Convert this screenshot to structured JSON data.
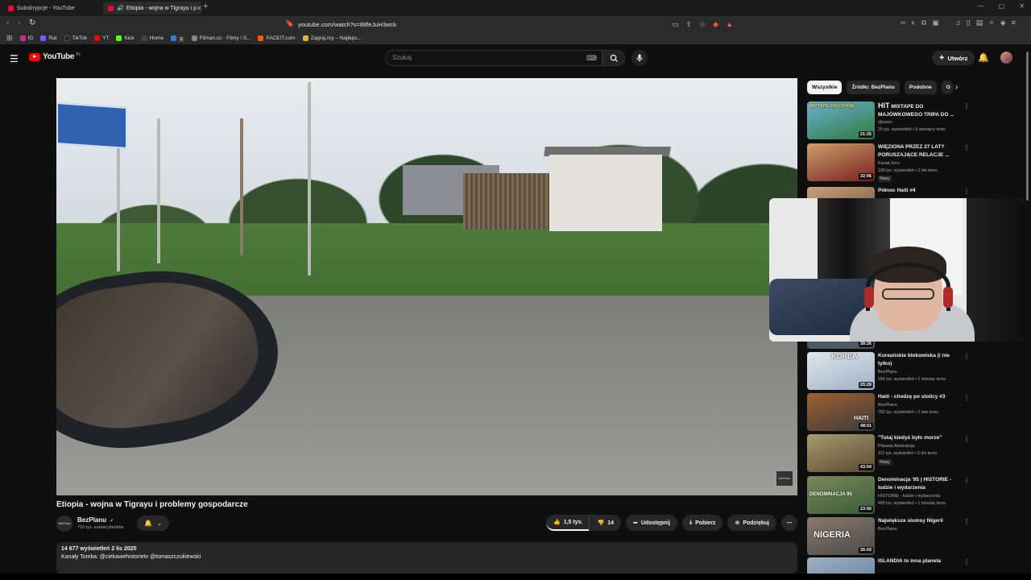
{
  "browser": {
    "tabs": [
      {
        "title": "Subskrypcje - YouTube",
        "active": false
      },
      {
        "title": "Etiopia - wojna w Tigrayu i p",
        "active": true
      }
    ],
    "url": "youtube.com/watch?v=88feJuH3wck",
    "bookmarks": [
      {
        "label": "IG",
        "color": "#d6249f"
      },
      {
        "label": "Rat",
        "color": "#7c5cff"
      },
      {
        "label": "TikTok",
        "color": "#222222"
      },
      {
        "label": "YT",
        "color": "#ff0000"
      },
      {
        "label": "Kick",
        "color": "#53fc18"
      },
      {
        "label": "Home",
        "color": "#444444"
      },
      {
        "label": "天",
        "color": "#3a7bd5"
      },
      {
        "label": "Filman.cc - Filmy i S...",
        "color": "#888888"
      },
      {
        "label": "FACEIT.com",
        "color": "#ff5500"
      },
      {
        "label": "Zagraj.my – Najleps...",
        "color": "#e2b23a"
      }
    ]
  },
  "header": {
    "logo_text": "YouTube",
    "logo_country": "PL",
    "search_placeholder": "Szukaj",
    "create_label": "Utwórz"
  },
  "video": {
    "title": "Etiopia - wojna w Tigrayu i problemy gospodarcze",
    "watermark": "BezPlanu",
    "channel": {
      "avatar_text": "BezPlanu",
      "name": "BezPlanu",
      "subscribers": "719 tys. subskrybentów"
    },
    "actions": {
      "likes": "1,5 tys.",
      "dislikes": "14",
      "share": "Udostępnij",
      "download": "Pobierz",
      "thanks": "Podziękuj"
    },
    "description": {
      "meta": "14 677 wyświetleń  2 lis 2025",
      "text_prefix": "Kanały Tomka:",
      "link1": "@ciekawehistorietv",
      "link2": "@tomaszczukiewski"
    }
  },
  "sidebar": {
    "chips": [
      "Wszystkie",
      "Źródło: BezPlanu",
      "Podobne",
      "O"
    ],
    "recommendations": [
      {
        "title": "MIXTAPE DO MAJÓWKOWEGO TRIPA DO ...",
        "channel": "rjbusen",
        "meta": "25 tys. wyświetleń • 6 miesięcy temu",
        "duration": "21:25",
        "thumb_text": "MIXTAPE ZAKOPANE",
        "colors": [
          "#2f7a3a",
          "#6bb0d6"
        ],
        "badge": "",
        "prefix": "HIT"
      },
      {
        "title": "WIĘZIONA PRZEZ 27 LAT? PORUSZAJĄCE RELACJE ...",
        "channel": "Kanał Zero",
        "meta": "136 tys. wyświetleń • 2 dni temu",
        "duration": "32:06",
        "thumb_text": "",
        "colors": [
          "#7a2020",
          "#caa06a"
        ],
        "badge": "Nowy",
        "prefix": ""
      },
      {
        "title": "Północ Haiti #4",
        "channel": "BezPlanu",
        "meta": "",
        "duration": "",
        "thumb_text": "",
        "colors": [
          "#c9a27c",
          "#6a4a32"
        ],
        "badge": "",
        "prefix": ""
      },
      {
        "title": "Koreańskie blokowiska (i nie tylko)",
        "channel": "BezPlanu",
        "meta": "266 tys. wyświetleń • 1 miesiąc temu",
        "duration": "25:29",
        "thumb_text": "KOREA",
        "colors": [
          "#9fb2c6",
          "#dfe6ee"
        ],
        "badge": "",
        "prefix": ""
      },
      {
        "title": "Haiti - chodzę po stolicy #3",
        "channel": "BezPlanu",
        "meta": "782 tys. wyświetleń • 2 lata temu",
        "duration": "48:01",
        "thumb_text": "HAITI",
        "colors": [
          "#3b3b3b",
          "#a06030"
        ],
        "badge": "",
        "prefix": ""
      },
      {
        "title": "\"Tutaj kiedyś było morze\"",
        "channel": "Planeta Abstrakcja",
        "meta": "112 tys. wyświetleń • 2 dni temu",
        "duration": "43:54",
        "thumb_text": "",
        "colors": [
          "#5a4a2e",
          "#a89a72"
        ],
        "badge": "Nowy",
        "prefix": ""
      },
      {
        "title": "Denominacja '95 | HISTORIE - ludzie i wydarzenia",
        "channel": "HISTORIE - ludzie i wydarzenia",
        "meta": "400 tys. wyświetleń • 1 miesiąc temu",
        "duration": "23:50",
        "thumb_text": "DENOMINACJA 95",
        "colors": [
          "#3a5a3a",
          "#7a8a5a"
        ],
        "badge": "",
        "prefix": ""
      },
      {
        "title": "Największe slumsy Nigerii",
        "channel": "BezPlanu",
        "meta": "",
        "duration": "35:03",
        "thumb_text": "NIGERIA",
        "colors": [
          "#4a4a4a",
          "#8a7a6a"
        ],
        "badge": "",
        "prefix": ""
      },
      {
        "title": "ISLANDIA to inna planeta",
        "channel": "",
        "meta": "",
        "duration": "",
        "thumb_text": "",
        "colors": [
          "#5a7a9a",
          "#a0b0c0"
        ],
        "badge": "",
        "prefix": ""
      }
    ],
    "partial_duration": "38:26"
  }
}
